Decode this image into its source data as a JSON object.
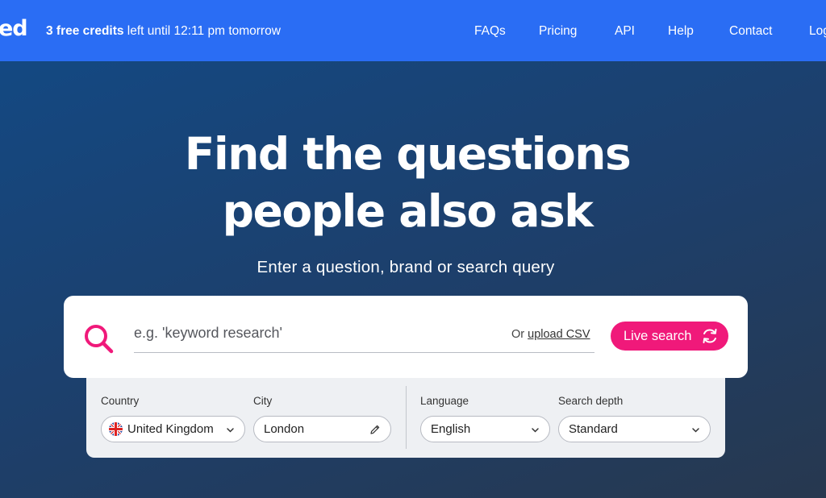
{
  "header": {
    "logo_fragment": "ed",
    "credits_bold": "3 free credits",
    "credits_rest": " left until 12:11 pm tomorrow",
    "nav": [
      {
        "label": "FAQs"
      },
      {
        "label": "Pricing"
      },
      {
        "label": "API"
      },
      {
        "label": "Help"
      },
      {
        "label": "Contact"
      },
      {
        "label": "Log"
      }
    ]
  },
  "hero": {
    "title_line1": "Find the questions",
    "title_line2": "people also ask",
    "subtitle": "Enter a question, brand or search query"
  },
  "search": {
    "placeholder": "e.g. 'keyword research'",
    "value": "",
    "or_text": "Or ",
    "upload_label": "upload CSV",
    "button_label": "Live search",
    "icon": "search-icon"
  },
  "options": {
    "country": {
      "label": "Country",
      "value": "United Kingdom",
      "flag": "uk-flag-icon"
    },
    "city": {
      "label": "City",
      "value": "London"
    },
    "language": {
      "label": "Language",
      "value": "English"
    },
    "depth": {
      "label": "Search depth",
      "value": "Standard"
    }
  },
  "colors": {
    "nav_bg": "#2a6df4",
    "accent": "#f0197a",
    "panel_bg": "#eef0f3"
  }
}
